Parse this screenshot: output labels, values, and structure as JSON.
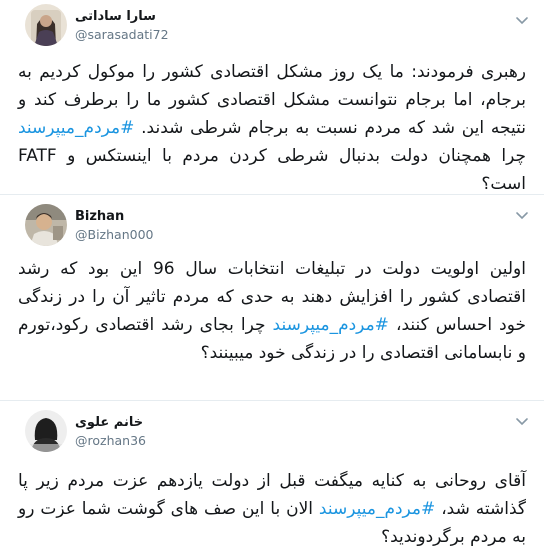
{
  "tweets": [
    {
      "name": "سارا ساداتی",
      "handle": "@sarasadati72",
      "text_before": "رهبری فرمودند: ما یک روز مشکل اقتصادی کشور را موکول کردیم به برجام، اما برجام نتوانست مشکل اقتصادی کشور ما را برطرف کند و نتیجه این شد که مردم نسبت به برجام شرطی شدند. ",
      "hashtag": "#مردم_میپرسند",
      "text_after": " چرا همچنان دولت بدنبال شرطی کردن مردم با اینستکس و FATF است؟"
    },
    {
      "name": "Bizhan",
      "handle": "@Bizhan000",
      "text_before": "اولین اولویت دولت در تبلیغات انتخابات سال 96 این بود که رشد اقتصادی کشور را افزایش دهند به حدی که مردم تاثیر آن را در زندگی خود احساس کنند، ",
      "hashtag": "#مردم_میپرسند",
      "text_after": " چرا بجای رشد اقتصادی رکود،تورم و نابسامانی اقتصادی را در زندگی خود میبینند؟"
    },
    {
      "name": "خانم علوی",
      "handle": "@rozhan36",
      "text_before": "آقای روحانی به کنایه میگفت قبل از دولت یازدهم عزت مردم زیر پا گذاشته شد، ",
      "hashtag": "#مردم_میپرسند",
      "text_after": " الان با این صف های گوشت شما عزت رو به مردم برگردوندید؟"
    }
  ],
  "colors": {
    "hashtag": "#1b95e0",
    "handle": "#657786",
    "divider": "#e6ecf0"
  },
  "icons": {
    "menu": "chevron-down-icon"
  }
}
